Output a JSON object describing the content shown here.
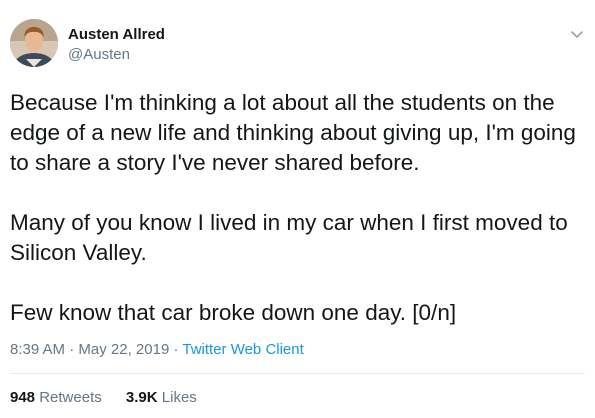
{
  "author": {
    "name": "Austen Allred",
    "handle": "@Austen"
  },
  "tweet": {
    "paragraphs": [
      "Because I'm thinking a lot about all the students on the edge of a new life and thinking about giving up, I'm going to share a story I've never shared before.",
      "Many of you know I lived in my car when I first moved to Silicon Valley.",
      "Few know that car broke down one day. [0/n]"
    ]
  },
  "meta": {
    "time": "8:39 AM",
    "separator1": " · ",
    "date": "May 22, 2019",
    "separator2": " · ",
    "source": "Twitter Web Client"
  },
  "stats": {
    "retweets_count": "948",
    "retweets_label": "Retweets",
    "likes_count": "3.9K",
    "likes_label": "Likes"
  },
  "icons": {
    "menu": "chevron-down-icon"
  },
  "colors": {
    "text": "#14171a",
    "secondary": "#657786",
    "link": "#1b95e0",
    "divider": "#e6ecf0"
  }
}
